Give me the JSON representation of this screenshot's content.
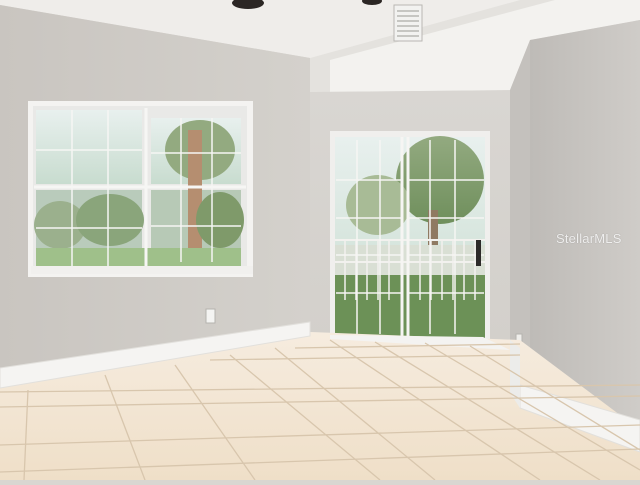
{
  "photo": {
    "scene": "empty-room-interior",
    "watermark": "StellarMLS",
    "colors": {
      "wall_left": "#cfcbc6",
      "wall_back": "#d6d2cd",
      "wall_right": "#c8c5c1",
      "ceiling": "#efedea",
      "floor_tile": "#f1e2cc",
      "grout": "#d8c6ad",
      "trim": "#f7f6f4",
      "foliage": "#7f9a6a",
      "tree_trunk": "#b58e70"
    }
  }
}
